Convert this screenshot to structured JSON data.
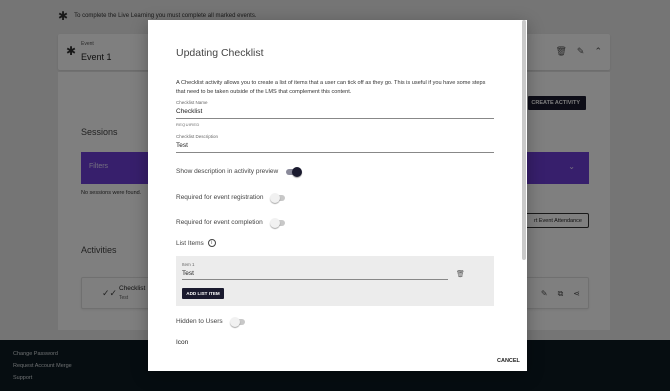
{
  "background": {
    "notice": "To complete the Live Learning you must complete all marked events.",
    "event_card": {
      "label": "Event",
      "name": "Event 1"
    },
    "create_activity_label": "CREATE ACTIVITY",
    "sessions_heading": "Sessions",
    "filters_label": "Filters",
    "no_sessions": "No sessions were found.",
    "export_label": "rt Event Attendance",
    "activities_heading": "Activities",
    "activity": {
      "name": "Checklist",
      "subtitle": "Test"
    }
  },
  "footer": {
    "links": [
      "Change Password",
      "Request Account Merge",
      "Support"
    ]
  },
  "modal": {
    "title": "Updating Checklist",
    "description": "A Checklist activity allows you to create a list of items that a user can tick off as they go. This is useful if you have some steps that need to be taken outside of the LMS that complement this content.",
    "name_label": "Checklist Name",
    "name_value": "Checklist",
    "required_label": "REQUIRED",
    "desc_label": "Checklist Description",
    "desc_value": "Test",
    "toggles": {
      "show_description": {
        "label": "Show description in activity preview",
        "on": true
      },
      "required_registration": {
        "label": "Required for event registration",
        "on": false
      },
      "required_completion": {
        "label": "Required for event completion",
        "on": false
      },
      "hidden_to_users": {
        "label": "Hidden to Users",
        "on": false
      }
    },
    "list_items_label": "List Items",
    "item": {
      "label": "Item 1",
      "value": "Test"
    },
    "add_item_label": "ADD LIST ITEM",
    "icon_heading": "Icon",
    "cancel_label": "CANCEL"
  }
}
